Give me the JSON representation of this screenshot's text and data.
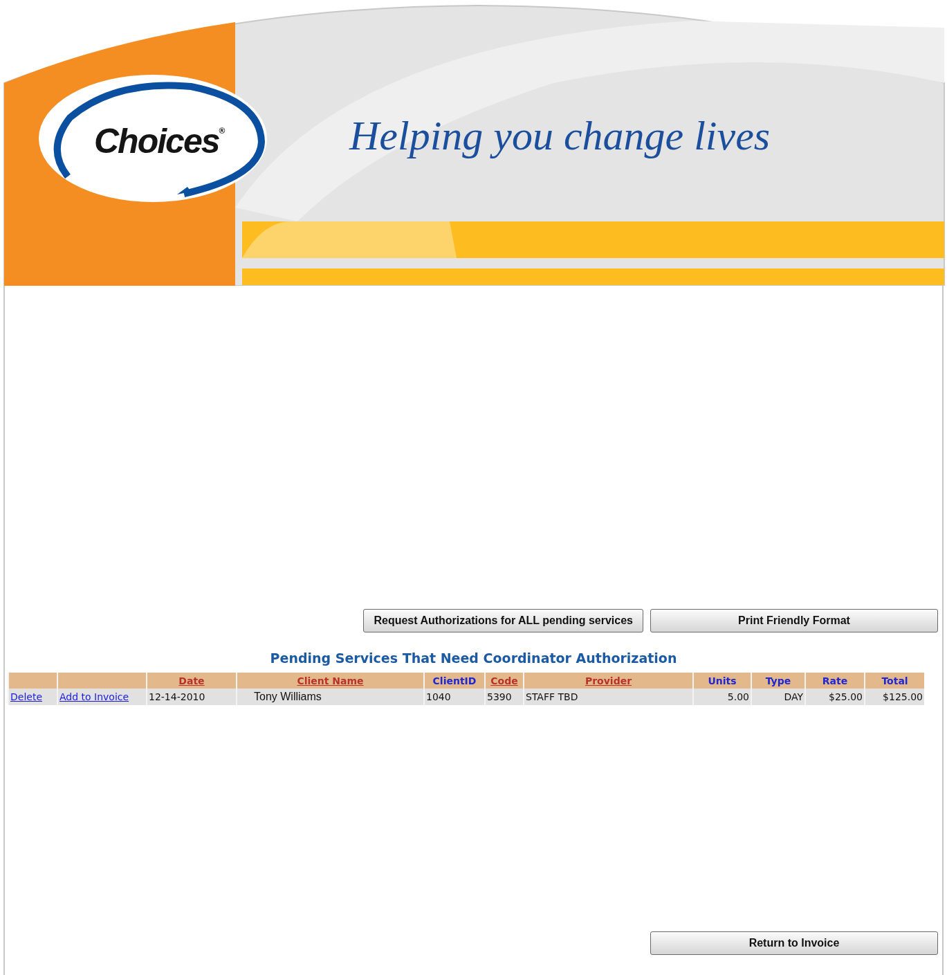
{
  "header": {
    "logo": "Choices$^{®}$",
    "tagline": "Helping you change lives"
  },
  "actions": [
    {
      "label": "Request Authorizations for ALL pending services"
    },
    {
      "label": "Print Friendly Format"
    }
  ],
  "section_title": "Pending Services That Need Coordinator Authorization",
  "table": {
    "columns": [
      {
        "kind": "blank"
      },
      {
        "kind": "blank"
      },
      {
        "kind": "sort-link",
        "label": "Date"
      },
      {
        "kind": "sort-link",
        "label": "Client Name"
      },
      {
        "kind": "plain",
        "label": "ClientID"
      },
      {
        "kind": "sort-link",
        "label": "Code"
      },
      {
        "kind": "sort-link",
        "label": "Provider"
      },
      {
        "kind": "plain",
        "label": "Units"
      },
      {
        "kind": "plain",
        "label": "Type"
      },
      {
        "kind": "plain",
        "label": "Rate"
      },
      {
        "kind": "plain",
        "label": "Total"
      }
    ],
    "rows": [
      {
        "cells": [
          {
            "kind": "link",
            "text": "Delete"
          },
          {
            "kind": "link",
            "text": "Add to Invoice"
          },
          {
            "kind": "text",
            "text": "12-14-2010"
          },
          {
            "kind": "name",
            "text": "Tony Williams"
          },
          {
            "kind": "text",
            "text": "1040"
          },
          {
            "kind": "text",
            "text": "5390"
          },
          {
            "kind": "text",
            "text": "STAFF TBD"
          },
          {
            "kind": "number",
            "text": "5.00"
          },
          {
            "kind": "number",
            "text": "DAY"
          },
          {
            "kind": "number",
            "text": "$25.00"
          },
          {
            "kind": "number",
            "text": "$125.00"
          }
        ]
      }
    ]
  },
  "footer_button": {
    "label": "Return to Invoice"
  }
}
